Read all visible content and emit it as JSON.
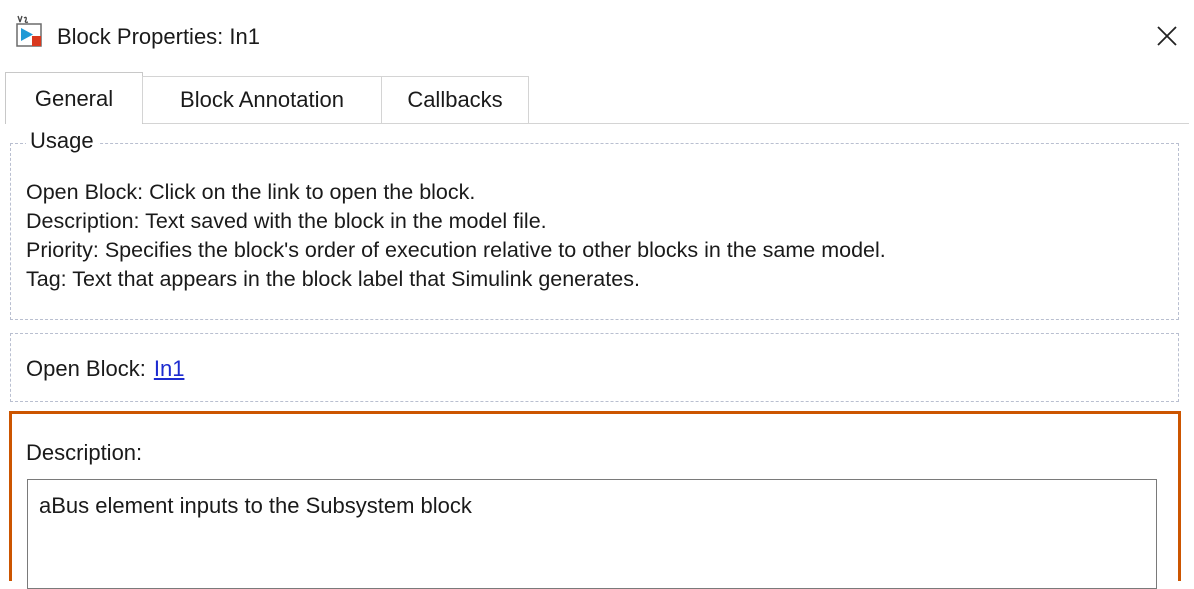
{
  "window": {
    "title": "Block Properties: In1",
    "app_icon": "simulink-block-icon",
    "close_icon": "close-icon"
  },
  "tabs": [
    {
      "label": "General",
      "active": true
    },
    {
      "label": "Block Annotation",
      "active": false
    },
    {
      "label": "Callbacks",
      "active": false
    }
  ],
  "usage": {
    "legend": "Usage",
    "lines": [
      "Open Block: Click on the link to open the block.",
      "Description: Text saved with the block in the model file.",
      "Priority: Specifies the block's order of execution relative to other blocks in the same model.",
      "Tag: Text that appears in the block label that Simulink generates."
    ]
  },
  "open_block": {
    "label": "Open Block:",
    "link": "In1"
  },
  "description": {
    "label": "Description:",
    "value": "aBus element inputs to the Subsystem block"
  },
  "colors": {
    "highlight_border": "#cc5500",
    "link": "#1d2bd0"
  }
}
